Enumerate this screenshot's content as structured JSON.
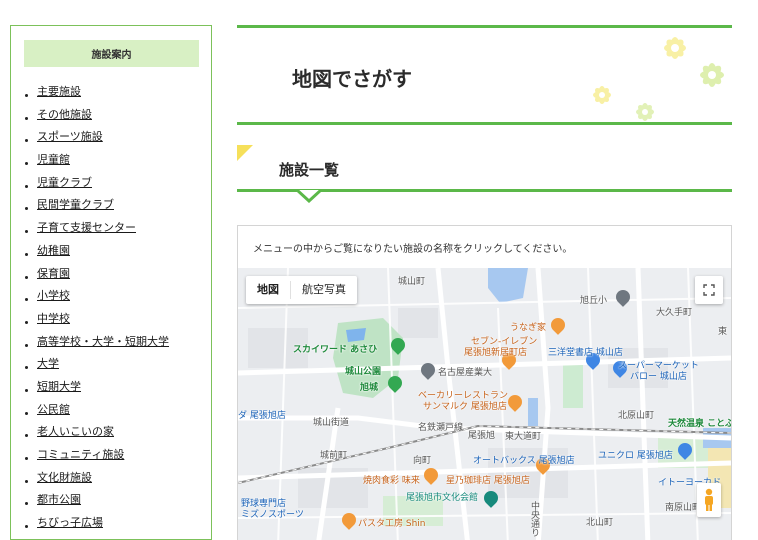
{
  "sidebar": {
    "heading": "施設案内",
    "items": [
      "主要施設",
      "その他施設",
      "スポーツ施設",
      "児童館",
      "児童クラブ",
      "民間学童クラブ",
      "子育て支援センター",
      "幼稚園",
      "保育園",
      "小学校",
      "中学校",
      "高等学校・大学・短期大学",
      "大学",
      "短期大学",
      "公民館",
      "老人いこいの家",
      "コミュニティ施設",
      "文化財施設",
      "都市公園",
      "ちびっ子広場"
    ]
  },
  "page": {
    "title": "地図でさがす"
  },
  "section": {
    "heading": "施設一覧"
  },
  "map": {
    "description": "メニューの中からご覧になりたい施設の名称をクリックしてください。",
    "type_buttons": [
      "地図",
      "航空写真"
    ],
    "labels": {
      "castle_town": "城山町",
      "kaiouoka": "旭丘小",
      "ohisa": "大久手町",
      "higashi": "東",
      "unagi": "うなぎ家",
      "seven": "セブン-イレブン",
      "seven2": "尾張旭新居町店",
      "sanyodo": "三洋堂書店 城山店",
      "super1": "スーパーマーケット",
      "super2": "バロー 城山店",
      "skyward": "スカイワード あさひ",
      "castle_park": "城山公園",
      "nagoya_univ": "名古屋産業大",
      "asahi_castle": "旭城",
      "bakery1": "ベーカリーレストラン",
      "bakery2": "サンマルク 尾張旭店",
      "kitahara": "北原山町",
      "onsen": "天然温泉 ことぶ",
      "owari_asahi": "尾張旭",
      "higashi_dai": "東大道町",
      "shiroyama_kaido": "城山街道",
      "meitetsu": "名鉄瀬戸線",
      "yasumachi": "城前町",
      "autobacs": "オートバックス 尾張旭店",
      "uniqlo": "ユニクロ 尾張旭店",
      "mukai": "向町",
      "yakiniku": "焼肉食彩 味来",
      "hoshino": "星乃珈琲店 尾張旭店",
      "ito_yokado": "イトーヨーカド",
      "shimin_kaikan": "尾張旭市文化会館",
      "minami_hara": "南原山町",
      "kitayama": "北山町",
      "pasta": "パスタ工房 Shin",
      "baseball1": "野球専門店",
      "baseball2": "ミズノスポーツ",
      "west_asahi": "ダ 尾張旭店",
      "chuo": "中央通り"
    }
  },
  "colors": {
    "accent": "#5bb849",
    "accent_light": "#d8f0c4",
    "yellow": "#f6e05a"
  }
}
